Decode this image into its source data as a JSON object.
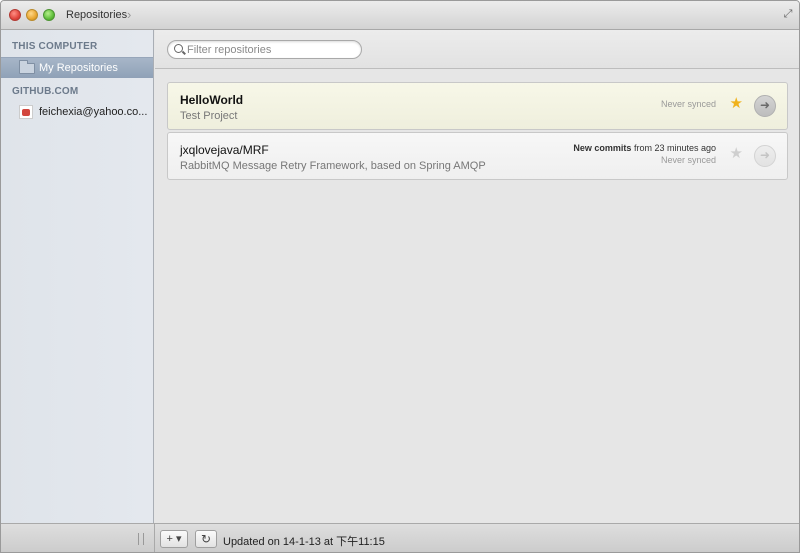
{
  "window": {
    "title": "Repositories"
  },
  "sidebar": {
    "section_local": "THIS COMPUTER",
    "local_items": [
      {
        "label": "My Repositories",
        "selected": true
      }
    ],
    "section_github": "GITHUB.COM",
    "github_items": [
      {
        "label": "feichexia@yahoo.co..."
      }
    ]
  },
  "search": {
    "placeholder": "Filter repositories",
    "value": ""
  },
  "repositories": [
    {
      "name": "HelloWorld",
      "description": "Test Project",
      "status": "Never synced",
      "starred": true
    },
    {
      "name": "jxqlovejava/MRF",
      "description": "RabbitMQ Message Retry Framework, based on Spring AMQP",
      "new_commits_label": "New commits",
      "new_commits_time": "from 23 minutes ago",
      "status": "Never synced",
      "starred": false
    }
  ],
  "statusbar": {
    "add_label": "+ ▾",
    "refresh_label": "↻",
    "updated_text": "Updated on 14-1-13 at 下午11:15"
  },
  "colors": {
    "highlight_row": "#f3f3e1",
    "star_on": "#f0b21c",
    "sidebar_selected": "#9aabc0"
  }
}
